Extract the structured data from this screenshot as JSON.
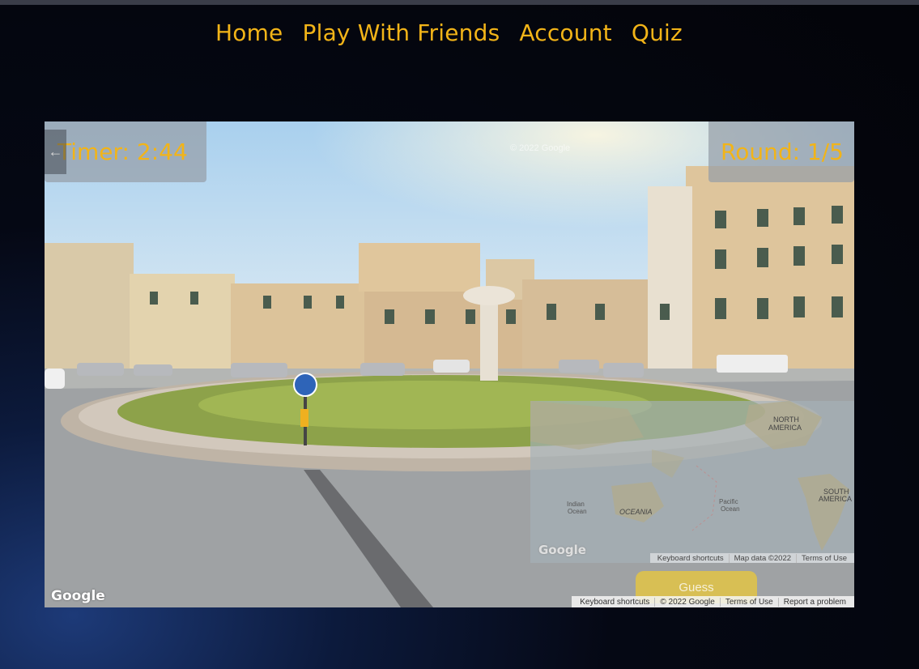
{
  "nav": {
    "home": "Home",
    "play": "Play With Friends",
    "account": "Account",
    "quiz": "Quiz"
  },
  "game": {
    "timer": "Timer: 2:44",
    "round": "Round: 1/5",
    "back_icon": "←",
    "guess": "Guess",
    "pano_watermark": "© 2022 Google",
    "google_logo": "Google"
  },
  "pano_attr": {
    "shortcuts": "Keyboard shortcuts",
    "copyright": "© 2022 Google",
    "terms": "Terms of Use",
    "report": "Report a problem"
  },
  "minimap": {
    "labels": {
      "north_america": "NORTH\nAMERICA",
      "south_america": "SOUTH\nAMERICA",
      "oceania": "OCEANIA",
      "indian": "Indian\nOcean",
      "pacific": "Pacific\nOcean"
    },
    "google_logo": "Google",
    "attr": {
      "shortcuts": "Keyboard shortcuts",
      "mapdata": "Map data ©2022",
      "terms": "Terms of Use"
    }
  },
  "colors": {
    "accent": "#f2b418",
    "background": "#050814"
  }
}
